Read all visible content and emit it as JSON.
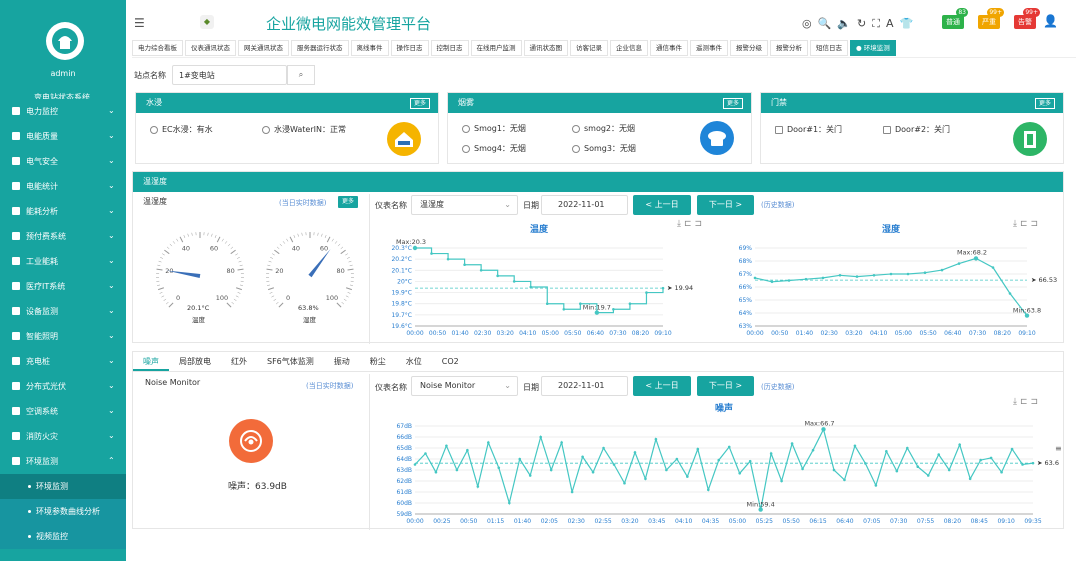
{
  "app": {
    "title": "企业微电网能效管理平台",
    "user": "admin"
  },
  "sidebar": {
    "cut_label": "变电站状态系统",
    "items": [
      {
        "label": "电力监控"
      },
      {
        "label": "电能质量"
      },
      {
        "label": "电气安全"
      },
      {
        "label": "电能统计"
      },
      {
        "label": "能耗分析"
      },
      {
        "label": "预付费系统"
      },
      {
        "label": "工业能耗"
      },
      {
        "label": "医疗IT系统"
      },
      {
        "label": "设备监测"
      },
      {
        "label": "智能照明"
      },
      {
        "label": "充电桩"
      },
      {
        "label": "分布式光伏"
      },
      {
        "label": "空调系统"
      },
      {
        "label": "消防火灾"
      },
      {
        "label": "环境监测"
      }
    ],
    "subitems": [
      {
        "label": "环境监测"
      },
      {
        "label": "环境参数曲线分析"
      },
      {
        "label": "视频监控"
      }
    ]
  },
  "topbar": {
    "badges": [
      {
        "label": "普通",
        "count": "83",
        "color": "#2db24a"
      },
      {
        "label": "严重",
        "count": "99+",
        "color": "#f0a500"
      },
      {
        "label": "告警",
        "count": "99+",
        "color": "#e53935"
      }
    ]
  },
  "tabs": [
    "电力综合看板",
    "仪表通讯状态",
    "网关通讯状态",
    "服务器运行状态",
    "离线事件",
    "操作日志",
    "控制日志",
    "在线用户监测",
    "通讯状态图",
    "访客记录",
    "企业信息",
    "通信事件",
    "遥测事件",
    "报警分级",
    "报警分析",
    "短信日志",
    "● 环境监测"
  ],
  "search": {
    "label": "站点名称",
    "value": "1#变电站"
  },
  "water": {
    "title": "水浸",
    "more": "更多",
    "items": [
      "EC水浸：有水",
      "水浸WaterIN：正常"
    ]
  },
  "smoke": {
    "title": "烟雾",
    "more": "更多",
    "items": [
      "Smog1：无烟",
      "smog2：无烟",
      "Smog4：无烟",
      "Somg3：无烟"
    ]
  },
  "door": {
    "title": "门禁",
    "more": "更多",
    "items": [
      "Door#1：关门",
      "Door#2：关门"
    ]
  },
  "th": {
    "title": "温湿度",
    "left_label": "温湿度",
    "realtime": "(当日实时数据)",
    "more": "更多",
    "meter_label": "仪表名称",
    "meter_value": "温湿度",
    "date_label": "日期",
    "date_value": "2022-11-01",
    "prev": "< 上一日",
    "next": "下一日 >",
    "history": "(历史数据)",
    "gauge1": {
      "value": "20.1°C",
      "name": "温度",
      "pct": 0.201
    },
    "gauge2": {
      "value": "63.8%",
      "name": "湿度",
      "pct": 0.638
    }
  },
  "noise": {
    "tabs": [
      "噪声",
      "局部放电",
      "红外",
      "SF6气体监测",
      "振动",
      "粉尘",
      "水位",
      "CO2"
    ],
    "left_label": "Noise Monitor",
    "realtime": "(当日实时数据)",
    "meter_label": "仪表名称",
    "meter_value": "Noise Monitor",
    "date_label": "日期",
    "date_value": "2022-11-01",
    "prev": "< 上一日",
    "next": "下一日 >",
    "history": "(历史数据)",
    "reading": "噪声：63.9dB"
  },
  "chart_data": [
    {
      "type": "line",
      "title": "温度",
      "x": [
        "00:00",
        "00:50",
        "01:40",
        "02:30",
        "03:20",
        "04:10",
        "05:00",
        "05:50",
        "06:40",
        "07:30",
        "08:20",
        "09:10"
      ],
      "yticks": [
        "19.6°C",
        "19.7°C",
        "19.8°C",
        "19.9°C",
        "20°C",
        "20.1°C",
        "20.2°C",
        "20.3°C"
      ],
      "ylim": [
        19.6,
        20.3
      ],
      "values": [
        20.3,
        20.25,
        20.2,
        20.15,
        20.1,
        20.05,
        20.0,
        19.95,
        19.8,
        19.75,
        19.8,
        19.72,
        19.75,
        19.8,
        19.9,
        19.94
      ],
      "max_label": "Max:20.3",
      "min_label": "Min:19.7",
      "avg_label": "19.94",
      "color": "#45c7c3"
    },
    {
      "type": "line",
      "title": "湿度",
      "x": [
        "00:00",
        "00:50",
        "01:40",
        "02:30",
        "03:20",
        "04:10",
        "05:00",
        "05:50",
        "06:40",
        "07:30",
        "08:20",
        "09:10"
      ],
      "yticks": [
        "63%",
        "64%",
        "65%",
        "66%",
        "67%",
        "68%",
        "69%"
      ],
      "ylim": [
        63,
        69
      ],
      "values": [
        66.7,
        66.4,
        66.5,
        66.6,
        66.7,
        66.9,
        66.8,
        66.9,
        67.0,
        67.0,
        67.1,
        67.3,
        67.8,
        68.2,
        67.5,
        65.5,
        63.8
      ],
      "max_label": "Max:68.2",
      "min_label": "Min:63.8",
      "avg_label": "66.53",
      "color": "#45c7c3"
    },
    {
      "type": "line",
      "title": "噪声",
      "x": [
        "00:00",
        "00:25",
        "00:50",
        "01:15",
        "01:40",
        "02:05",
        "02:30",
        "02:55",
        "03:20",
        "03:45",
        "04:10",
        "04:35",
        "05:00",
        "05:25",
        "05:50",
        "06:15",
        "06:40",
        "07:05",
        "07:30",
        "07:55",
        "08:20",
        "08:45",
        "09:10",
        "09:35"
      ],
      "yticks": [
        "59dB",
        "60dB",
        "61dB",
        "62dB",
        "63dB",
        "64dB",
        "65dB",
        "66dB",
        "67dB"
      ],
      "ylim": [
        59,
        67
      ],
      "values": [
        63.5,
        64.5,
        62.8,
        65.2,
        63.0,
        64.8,
        61.5,
        65.5,
        63.2,
        60.0,
        64.0,
        62.5,
        66.0,
        63.0,
        65.5,
        61.0,
        64.2,
        62.8,
        65.0,
        63.5,
        61.8,
        64.6,
        62.2,
        65.8,
        63.0,
        64.0,
        62.4,
        64.9,
        61.2,
        63.9,
        65.1,
        62.7,
        63.8,
        59.4,
        64.5,
        62.0,
        65.4,
        63.1,
        64.8,
        66.7,
        63.0,
        62.1,
        65.2,
        63.6,
        61.6,
        64.7,
        62.9,
        65.0,
        63.3,
        62.5,
        64.4,
        63.0,
        65.3,
        62.2,
        63.9,
        64.1,
        62.8,
        64.9,
        63.5,
        63.62
      ],
      "max_label": "Max:66.7",
      "min_label": "Min:59.4",
      "avg_label": "63.62",
      "color": "#45c7c3"
    }
  ]
}
